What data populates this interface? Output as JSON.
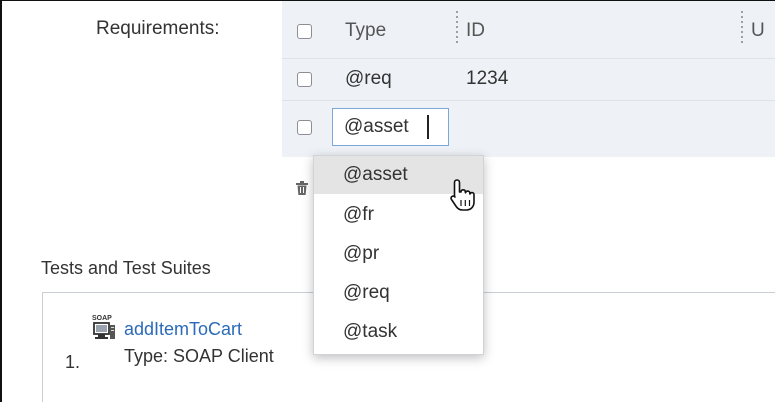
{
  "form": {
    "requirements_label": "Requirements:"
  },
  "grid": {
    "columns": [
      "Type",
      "ID",
      "U"
    ],
    "rows": [
      {
        "type": "@req",
        "id": "1234"
      }
    ],
    "edit_value": "@asset"
  },
  "dropdown": {
    "options": [
      "@asset",
      "@fr",
      "@pr",
      "@req",
      "@task"
    ],
    "highlighted": "@asset"
  },
  "tests": {
    "title": "Tests and Test Suites",
    "items": [
      {
        "index": "1.",
        "name": "addItemToCart",
        "type_text": "Type: SOAP Client",
        "icon": "soap-icon",
        "icon_text": "SOAP"
      }
    ]
  },
  "colors": {
    "grid_bg": "#eef2f7",
    "link": "#2a6ab8",
    "highlight": "#e4e4e4",
    "input_border": "#7da7d9"
  }
}
